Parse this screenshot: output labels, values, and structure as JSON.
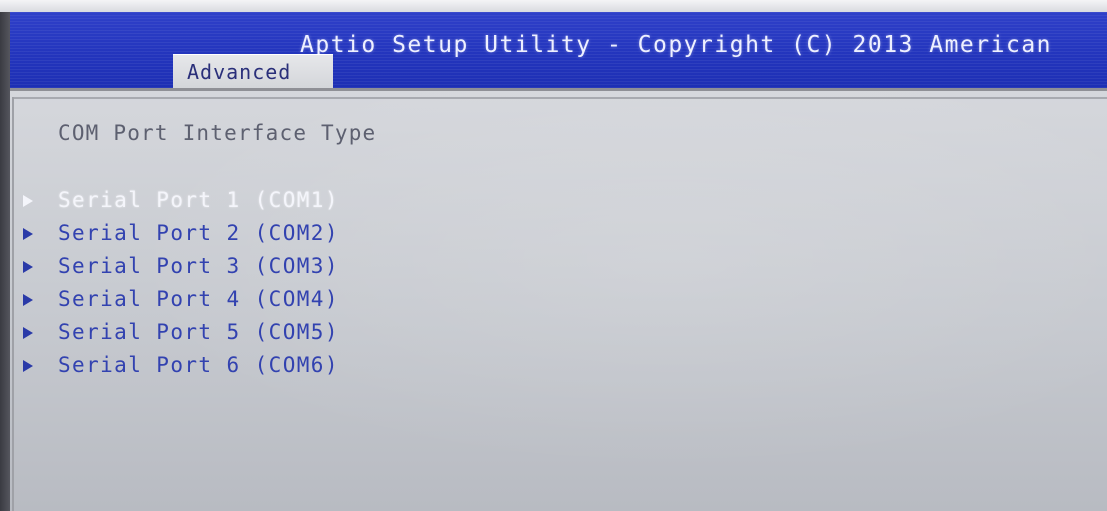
{
  "header": {
    "title": "Aptio Setup Utility - Copyright (C) 2013 American",
    "active_tab": "Advanced"
  },
  "content": {
    "section_title": "COM Port Interface Type",
    "items": [
      {
        "label": "Serial Port 1 (COM1)",
        "selected": true
      },
      {
        "label": "Serial Port 2 (COM2)",
        "selected": false
      },
      {
        "label": "Serial Port 3 (COM3)",
        "selected": false
      },
      {
        "label": "Serial Port 4 (COM4)",
        "selected": false
      },
      {
        "label": "Serial Port 5 (COM5)",
        "selected": false
      },
      {
        "label": "Serial Port 6 (COM6)",
        "selected": false
      }
    ]
  },
  "colors": {
    "header_blue": "#2335bd",
    "menu_text": "#3242b0",
    "selected_text": "#f4f5fb",
    "content_bg": "#c6c9cf",
    "tab_bg": "#d4d6da"
  },
  "icons": {
    "submenu_arrow": "right-triangle-icon"
  }
}
